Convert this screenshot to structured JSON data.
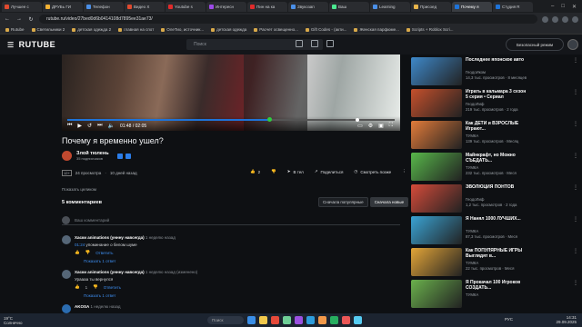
{
  "browser": {
    "tabs": [
      {
        "label": "Лучшее с",
        "color": "#e04a2f"
      },
      {
        "label": "ДРУБь ГИ",
        "color": "#f1b133"
      },
      {
        "label": "Телефон",
        "color": "#4a8fe7"
      },
      {
        "label": "Видео Х",
        "color": "#e04a2f"
      },
      {
        "label": "Youtube s",
        "color": "#e02b2b"
      },
      {
        "label": "Интересн",
        "color": "#9d4ae7"
      },
      {
        "label": "Пин на ка",
        "color": "#e02b2b"
      },
      {
        "label": "Звукозап",
        "color": "#4a8fe7"
      },
      {
        "label": "Ваш",
        "color": "#4ae78f"
      },
      {
        "label": "Learning",
        "color": "#4a8fe7"
      },
      {
        "label": "Присоед",
        "color": "#e7b44a"
      },
      {
        "label": "Почему я",
        "color": "#1e73d8"
      },
      {
        "label": "Студия R",
        "color": "#1e73d8"
      }
    ],
    "active_tab": 11,
    "url": "rutube.ru/video/27bed0d6b0414108d7895ee31ae73/",
    "bookmarks": [
      "Rutube",
      "Светильники 2",
      "детская одежда 2",
      "главная на спот",
      "ОлеТио, источник...",
      "детская одежда",
      "Расчет освещенно...",
      "Gift Codes - (акти...",
      "Женская парфюме...",
      "Scripts + Roblox Scri..."
    ]
  },
  "header": {
    "logo": "RUTUBE",
    "search_placeholder": "Поиск",
    "secure_mode": "Безопасный режим"
  },
  "player": {
    "time": "01:48 / 02:05"
  },
  "video": {
    "title": "Почему я временно ушел?",
    "channel_name": "Злой тюлень",
    "channel_subs": "35 подписчиков",
    "age": "12+",
    "views": "24 просмотра",
    "posted": "10 дней назад",
    "likes": "2",
    "share": "Поделиться",
    "watch_later": "Смотреть позже",
    "in_tg": "В тел",
    "show_all": "Показать целиком"
  },
  "comments": {
    "count": "5 комментариев",
    "sort_popular": "Сначала популярные",
    "sort_new": "Сначала новые",
    "input_placeholder": "Ваш комментарий",
    "items": [
      {
        "author": "Хаски animations (уннну навсегда)",
        "time": "1 неделю назад",
        "timestamp": "01:24",
        "text": "упоминание о белом шуме",
        "likes": "",
        "reply": "Ответить",
        "replies": "Показать 1 ответ",
        "avatar_color": "#556677"
      },
      {
        "author": "Хаски animations (уннну навсегда)",
        "time": "1 неделю назад (изменено)",
        "timestamp": "",
        "text": "Ураааа ты вернулся",
        "likes": "1",
        "reply": "Ответить",
        "replies": "Показать 1 ответ",
        "avatar_color": "#556677"
      },
      {
        "author": "AKOSA",
        "time": "1 неделю назад",
        "timestamp": "",
        "text": "",
        "likes": "",
        "reply": "",
        "replies": "",
        "avatar_color": "#2b6cb0"
      }
    ]
  },
  "recommendations": [
    {
      "title": "Последнее японское авто",
      "channel": "ГеодоИком",
      "views": "14,3 тыс. просмотров · 8 месяцев",
      "bg": "#3e88c9",
      "dur": ""
    },
    {
      "title": "Играть в кальмара 3 сезон 5 серия • Сериал",
      "channel": "ГеодоЛиф",
      "views": "219 тыс. просмотров · 2 года",
      "bg": "#c5502c",
      "dur": ""
    },
    {
      "title": "Как ДЕТИ и ВЗРОСЛЫЕ Играют...",
      "channel": "ТУМКА",
      "views": "139 тыс. просмотров · Месяц",
      "bg": "#e27b3a",
      "dur": ""
    },
    {
      "title": "Майнкрафт, но Можно СЪЕДАТЬ...",
      "channel": "ТУМКА",
      "views": "232 тыс. просмотров · Меся",
      "bg": "#58b74a",
      "dur": ""
    },
    {
      "title": "ЭВОЛЮЦИЯ ПОНТОВ",
      "channel": "ГеодоЛиф",
      "views": "1,2 тыс. просмотров · 2 года",
      "bg": "#d44b3a",
      "dur": ""
    },
    {
      "title": "Я Нанял 1000 ЛУЧШИХ...",
      "channel": "ТУМКА",
      "views": "87,3 тыс. просмотров · Меся",
      "bg": "#3aa3d4",
      "dur": ""
    },
    {
      "title": "Как ПОПУЛЯРНЫЕ ИГРЫ Выглядят в...",
      "channel": "ТУМКА",
      "views": "22 тыс. просмотров · Меся",
      "bg": "#e3a538",
      "dur": ""
    },
    {
      "title": "Я Прокачал 100 Игроков СОЗДАТЬ...",
      "channel": "ТУМКА",
      "views": "",
      "bg": "#6ab04c",
      "dur": ""
    }
  ],
  "taskbar": {
    "temp": "19°C",
    "weather": "Солнечно",
    "search": "Поиск",
    "lang": "РУС",
    "time": "14:31",
    "date": "29.09.2025",
    "app_colors": [
      "#3a8ee6",
      "#f2c94c",
      "#e64a3a",
      "#6fcf97",
      "#9b51e0",
      "#2d9cdb",
      "#f2994a",
      "#27ae60",
      "#eb5757",
      "#56ccf2"
    ]
  }
}
